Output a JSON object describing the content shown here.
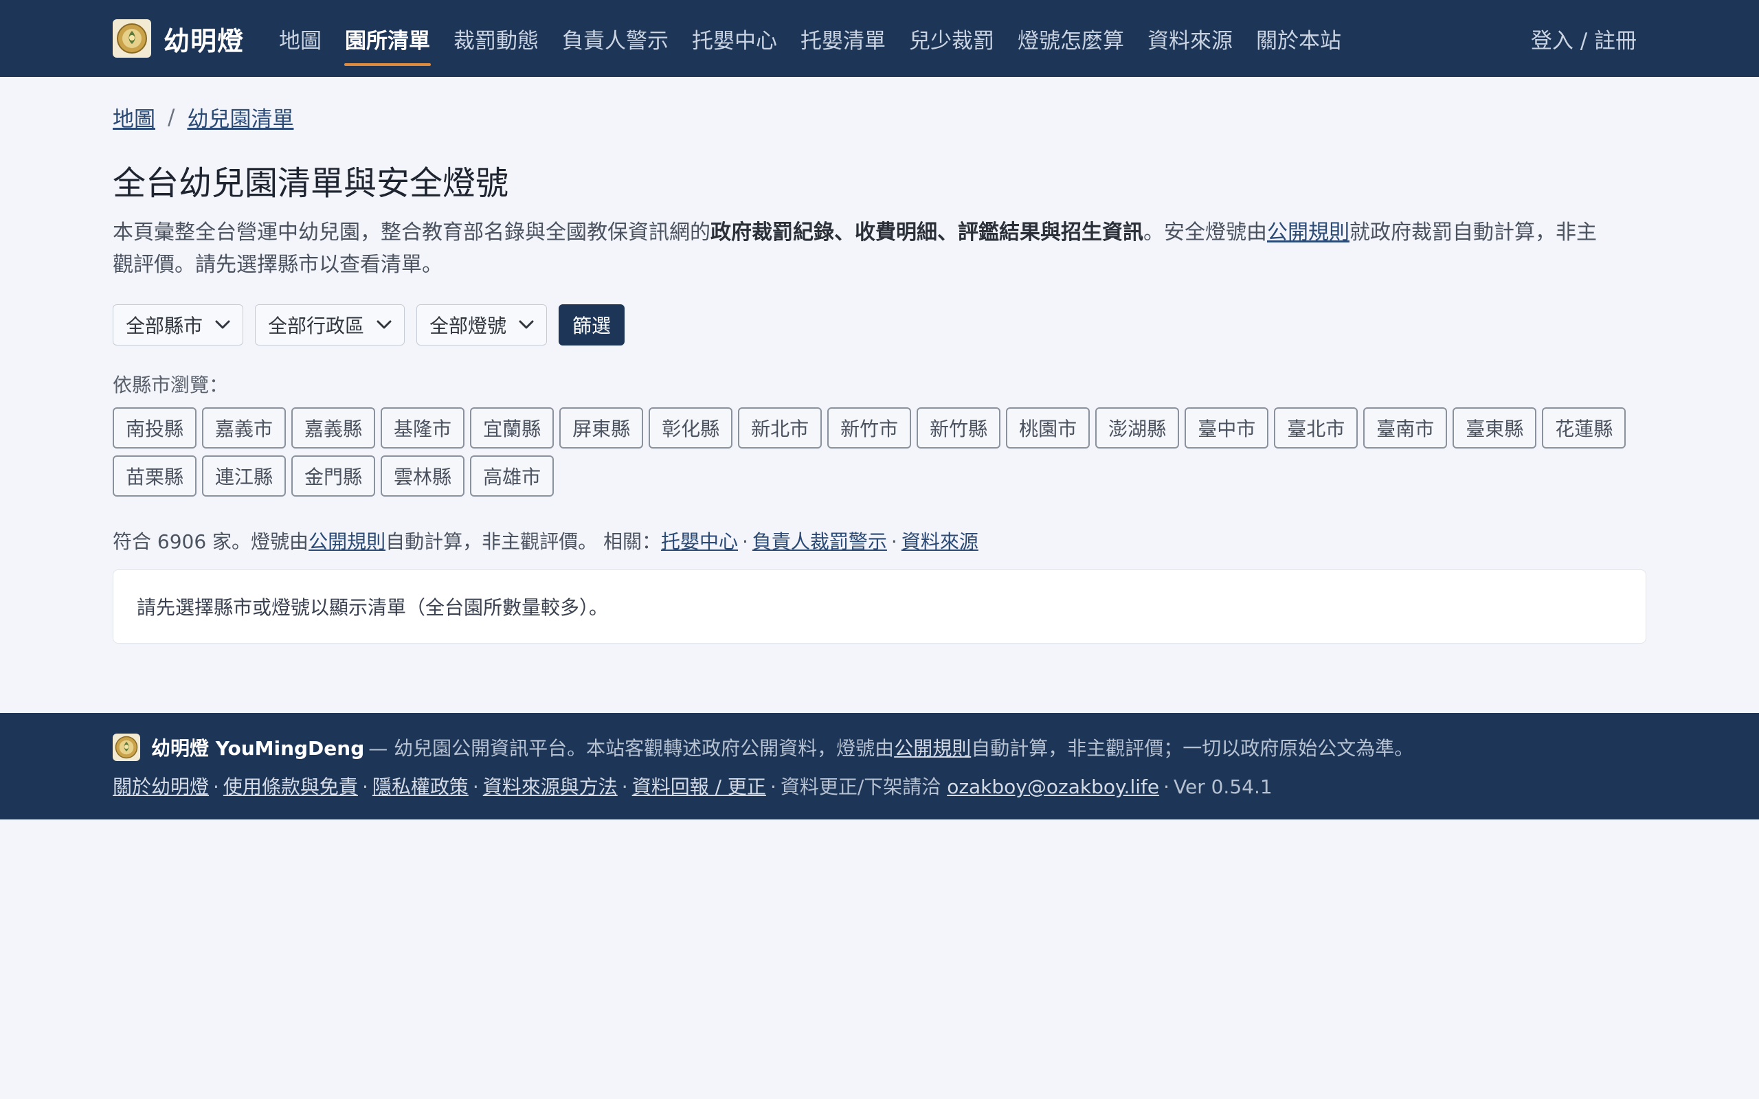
{
  "brand": {
    "name": "幼明燈",
    "logo_icon": "lamp-logo-icon"
  },
  "nav": {
    "items": [
      {
        "label": "地圖"
      },
      {
        "label": "園所清單",
        "active": true
      },
      {
        "label": "裁罰動態"
      },
      {
        "label": "負責人警示"
      },
      {
        "label": "托嬰中心"
      },
      {
        "label": "托嬰清單"
      },
      {
        "label": "兒少裁罰"
      },
      {
        "label": "燈號怎麼算"
      },
      {
        "label": "資料來源"
      },
      {
        "label": "關於本站"
      }
    ],
    "login": "登入 / 註冊"
  },
  "breadcrumb": {
    "home": "地圖",
    "sep": "/",
    "current": "幼兒園清單"
  },
  "page_title": "全台幼兒園清單與安全燈號",
  "intro": {
    "part1": "本頁彙整全台營運中幼兒園，整合教育部名錄與全國教保資訊網的",
    "bold": "政府裁罰紀錄、收費明細、評鑑結果與招生資訊",
    "part2": "。安全燈號由",
    "link": "公開規則",
    "part3": "就政府裁罰自動計算，非主觀評價。請先選擇縣市以查看清單。"
  },
  "filters": {
    "county": "全部縣市",
    "district": "全部行政區",
    "light": "全部燈號",
    "submit": "篩選"
  },
  "county_browse": {
    "label": "依縣市瀏覽：",
    "counties": [
      "南投縣",
      "嘉義市",
      "嘉義縣",
      "基隆市",
      "宜蘭縣",
      "屏東縣",
      "彰化縣",
      "新北市",
      "新竹市",
      "新竹縣",
      "桃園市",
      "澎湖縣",
      "臺中市",
      "臺北市",
      "臺南市",
      "臺東縣",
      "花蓮縣",
      "苗栗縣",
      "連江縣",
      "金門縣",
      "雲林縣",
      "高雄市"
    ]
  },
  "summary": {
    "prefix": "符合 6906 家。燈號由",
    "rule_link": "公開規則",
    "middle": "自動計算，非主觀評價。 相關：",
    "link1": "托嬰中心",
    "link2": "負責人裁罰警示",
    "link3": "資料來源",
    "dot": "·"
  },
  "notice": "請先選擇縣市或燈號以顯示清單（全台園所數量較多）。",
  "footer": {
    "brand": "幼明燈 YouMingDeng",
    "desc_prefix": "— 幼兒園公開資訊平台。本站客觀轉述政府公開資料，燈號由",
    "rule_link": "公開規則",
    "desc_suffix": "自動計算，非主觀評價；一切以政府原始公文為準。",
    "links": [
      "關於幼明燈",
      "使用條款與免責",
      "隱私權政策",
      "資料來源與方法",
      "資料回報 / 更正"
    ],
    "contact_prefix": "資料更正/下架請洽",
    "email": "ozakboy@ozakboy.life",
    "version": "Ver 0.54.1",
    "dot": "·"
  },
  "colors": {
    "navbar": "#1d3557",
    "accent_underline": "#e08a3c",
    "background": "#f3f5fa"
  }
}
